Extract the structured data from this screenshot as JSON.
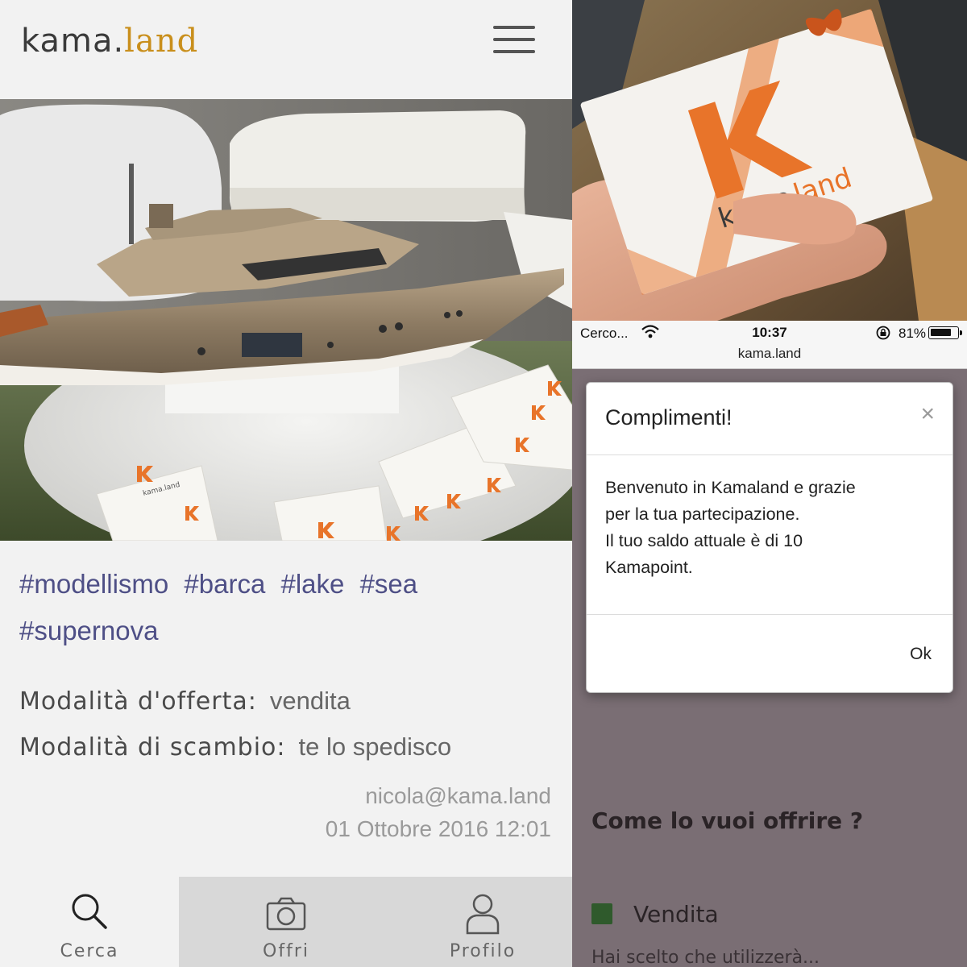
{
  "left": {
    "brand": {
      "part1": "kama.",
      "part2": "land"
    },
    "tags": [
      "#modellismo",
      "#barca",
      "#lake",
      "#sea",
      "#supernova"
    ],
    "offer_mode": {
      "label": "Modalità d'offerta:",
      "value": "vendita"
    },
    "exchange_mode": {
      "label": "Modalità di scambio:",
      "value": "te lo spedisco"
    },
    "author": "nicola@kama.land",
    "date": "01 Ottobre 2016 12:01",
    "nav": [
      {
        "label": "Cerca",
        "icon": "search-icon"
      },
      {
        "label": "Offri",
        "icon": "camera-icon"
      },
      {
        "label": "Profilo",
        "icon": "user-icon"
      }
    ],
    "photo_card_text": "kama.land"
  },
  "right": {
    "card_text": {
      "k": "K",
      "brand1": "kama.",
      "brand2": "land"
    },
    "status_bar": {
      "carrier": "Cerco...",
      "time": "10:37",
      "battery": "81%",
      "battery_level": 0.81
    },
    "url": "kama.land",
    "modal": {
      "title": "Complimenti!",
      "close": "×",
      "body_lines": [
        "Benvenuto in Kamaland e grazie",
        "per la tua partecipazione.",
        "Il tuo saldo attuale è di 10",
        "Kamapoint."
      ],
      "ok": "Ok"
    },
    "background_page": {
      "heading": "Come lo vuoi offrire ?",
      "option": "Vendita",
      "partial_text": "Hai scelto che utilizzerà..."
    }
  },
  "colors": {
    "brand_orange": "#e8742a",
    "brand_gold": "#c98f1c",
    "tag_blue": "#4e4f86",
    "option_green": "#2f5a2c"
  }
}
